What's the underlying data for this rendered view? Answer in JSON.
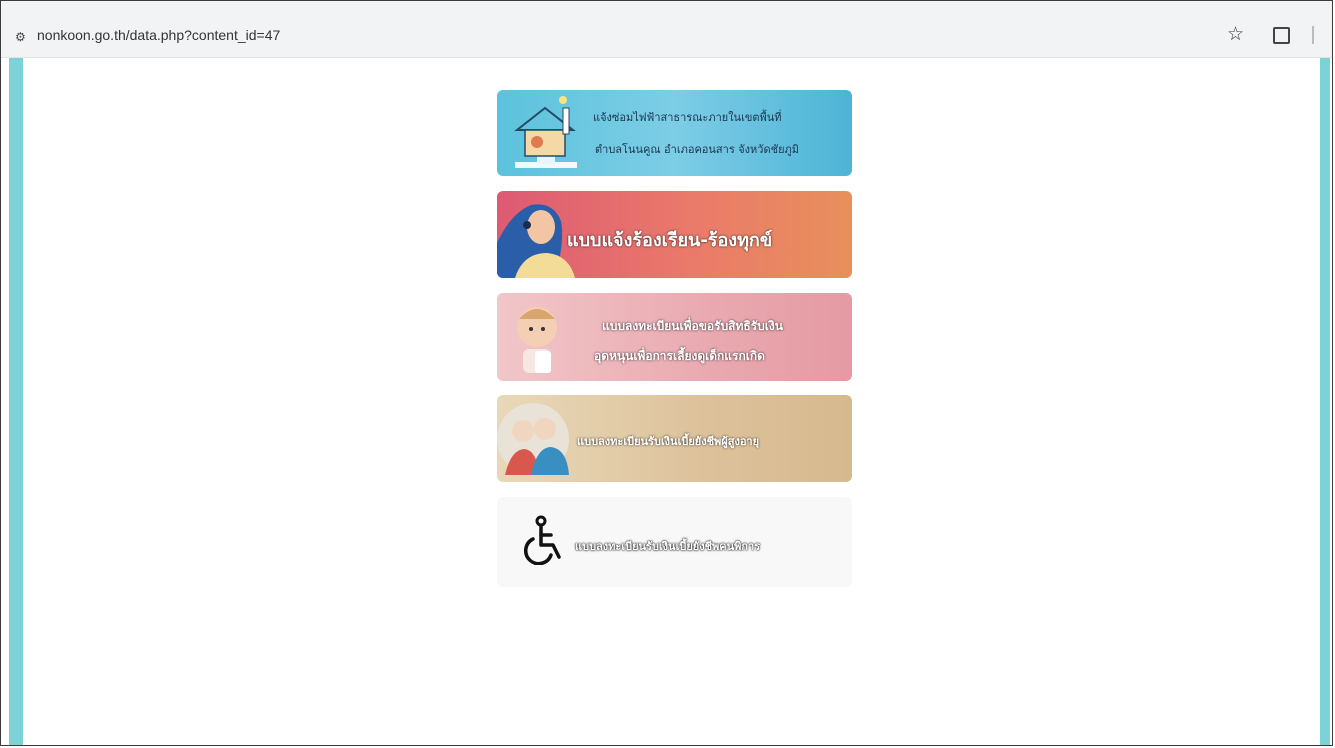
{
  "browser": {
    "url": "nonkoon.go.th/data.php?content_id=47",
    "site_info_icon": "tune-icon",
    "bookmark_icon": "star-icon",
    "extensions_icon": "puzzle-icon"
  },
  "accent_color": "#7dd2d8",
  "banners": [
    {
      "line1": "แจ้งซ่อมไฟฟ้าสาธารณะภายในเขตพื้นที่",
      "line2": "ตำบลโนนคูณ อำเภอคอนสาร จังหวัดชัยภูมิ",
      "icon": "house-lightbulb-icon",
      "color": "#5cc2dc"
    },
    {
      "line1": "แบบแจ้งร้องเรียน-ร้องทุกข์",
      "icon": "call-center-woman-icon",
      "color": "#e27266"
    },
    {
      "line1": "แบบลงทะเบียนเพื่อขอรับสิทธิรับเงิน",
      "line2": "อุดหนุนเพื่อการเลี้ยงดูเด็กแรกเกิด",
      "icon": "baby-icon",
      "color": "#eeb8bd"
    },
    {
      "line1": "แบบลงทะเบียนรับเงินเบี้ยยังชีพผู้สูงอายุ",
      "icon": "elderly-couple-icon",
      "color": "#dfc8a2"
    },
    {
      "line1": "แบบลงทะเบียนรับเงินเบี้ยยังชีพคนพิการ",
      "icon": "wheelchair-icon",
      "color": "#f8f8f9"
    }
  ]
}
